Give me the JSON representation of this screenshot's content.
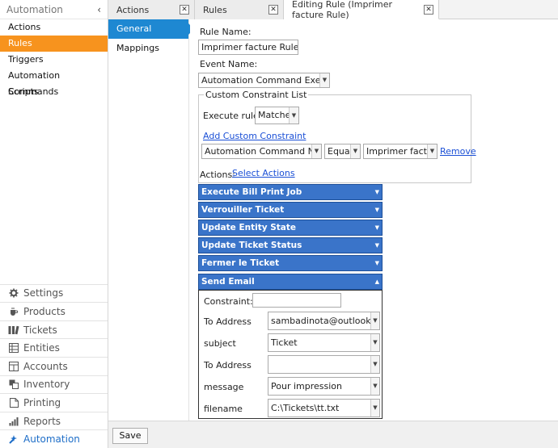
{
  "sidebar": {
    "header": "Automation",
    "collapse_glyph": "‹",
    "items": [
      {
        "label": "Actions"
      },
      {
        "label": "Rules",
        "active": true
      },
      {
        "label": "Triggers"
      },
      {
        "label": "Automation Commands"
      },
      {
        "label": "Scripts"
      }
    ],
    "nav": [
      {
        "label": "Settings",
        "icon": "gear-icon"
      },
      {
        "label": "Products",
        "icon": "cup-icon"
      },
      {
        "label": "Tickets",
        "icon": "tickets-icon"
      },
      {
        "label": "Entities",
        "icon": "entities-icon"
      },
      {
        "label": "Accounts",
        "icon": "accounts-icon"
      },
      {
        "label": "Inventory",
        "icon": "inventory-icon"
      },
      {
        "label": "Printing",
        "icon": "document-icon"
      },
      {
        "label": "Reports",
        "icon": "bar-chart-icon"
      },
      {
        "label": "Automation",
        "icon": "automation-icon",
        "current": true
      }
    ]
  },
  "tabs": [
    {
      "label": "Actions"
    },
    {
      "label": "Rules"
    },
    {
      "label": "Editing Rule (Imprimer facture Rule)",
      "active": true
    }
  ],
  "settings_nav": {
    "items": [
      {
        "label": "General Settings",
        "active": true
      },
      {
        "label": "Mappings"
      }
    ]
  },
  "form": {
    "rule_name_label": "Rule Name:",
    "rule_name_value": "Imprimer facture Rule",
    "event_name_label": "Event Name:",
    "event_name_value": "Automation Command Executed",
    "constraint_group_title": "Custom Constraint List",
    "execute_rule_label": "Execute rule if",
    "execute_rule_value": "Matches",
    "add_constraint_link": "Add Custom Constraint",
    "constraint_field": "Automation Command Name",
    "constraint_operator": "Equals",
    "constraint_value": "Imprimer facture",
    "remove_link": "Remove",
    "actions_label": "Actions:",
    "select_actions_link": "Select Actions",
    "actions": [
      {
        "label": "Execute Bill Print Job"
      },
      {
        "label": "Verrouiller Ticket"
      },
      {
        "label": "Update Entity State"
      },
      {
        "label": "Update Ticket Status"
      },
      {
        "label": "Fermer le Ticket"
      }
    ],
    "expanded_action": {
      "label": "Send Email",
      "constraint_label": "Constraint:",
      "constraint_value": "",
      "params": [
        {
          "label": "To Address",
          "value": "sambadinota@outlook.com"
        },
        {
          "label": "subject",
          "value": "Ticket"
        },
        {
          "label": "To Address",
          "value": ""
        },
        {
          "label": "message",
          "value": "Pour impression"
        },
        {
          "label": "filename",
          "value": "C:\\Tickets\\tt.txt"
        }
      ]
    }
  },
  "bottom_bar": {
    "save_label": "Save"
  },
  "colors": {
    "accent_orange": "#f7931e",
    "nav_blue": "#1e88d2",
    "action_blue": "#3a74c9",
    "link_blue": "#1a4fd6"
  }
}
